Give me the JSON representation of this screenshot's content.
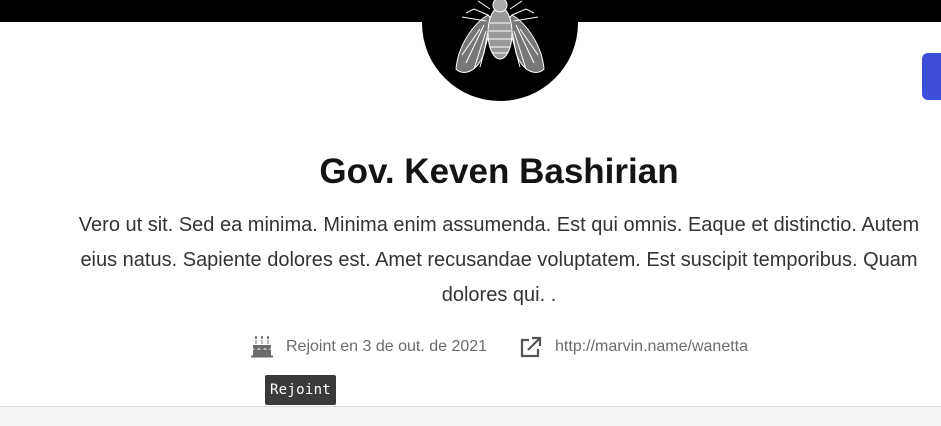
{
  "profile": {
    "name": "Gov. Keven Bashirian",
    "bio": "Vero ut sit. Sed ea minima. Minima enim assumenda. Est qui omnis. Eaque et distinctio. Autem eius natus. Sapiente dolores est. Amet recusandae voluptatem. Est suscipit temporibus. Quam dolores qui. ."
  },
  "meta": {
    "joined": {
      "icon": "cake-icon",
      "label": "Rejoint en 3 de out. de 2021"
    },
    "website": {
      "icon": "external-link-icon",
      "label": "http://marvin.name/wanetta"
    }
  },
  "tooltip": {
    "text": "Rejoint"
  },
  "colors": {
    "top_bar": "#000000",
    "accent_button": "#3d4ed8",
    "meta_text": "#6b6b6b",
    "tooltip_bg": "#3a3a3a"
  }
}
